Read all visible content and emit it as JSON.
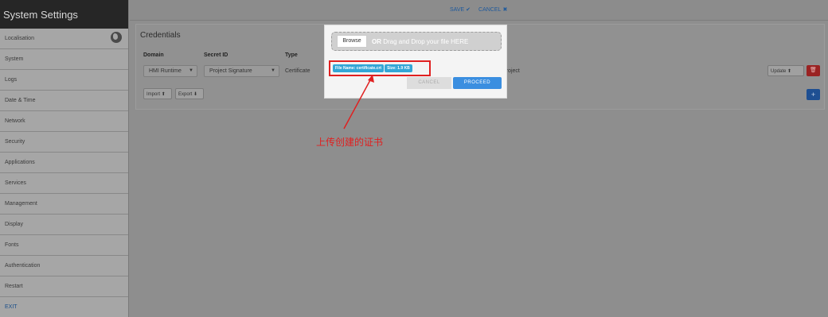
{
  "sidebar": {
    "title": "System Settings",
    "items": [
      {
        "label": "Localisation"
      },
      {
        "label": "System"
      },
      {
        "label": "Logs"
      },
      {
        "label": "Date & Time"
      },
      {
        "label": "Network"
      },
      {
        "label": "Security"
      },
      {
        "label": "Applications"
      },
      {
        "label": "Services"
      },
      {
        "label": "Management"
      },
      {
        "label": "Display"
      },
      {
        "label": "Fonts"
      },
      {
        "label": "Authentication"
      },
      {
        "label": "Restart"
      }
    ],
    "exit_label": "EXIT",
    "icon": "globe-icon"
  },
  "topbar": {
    "save_label": "SAVE",
    "cancel_label": "CANCEL",
    "save_icon": "check-icon",
    "cancel_icon": "x-icon",
    "accent_color": "#1f5a9c"
  },
  "credentials": {
    "title": "Credentials",
    "headers": {
      "domain": "Domain",
      "secret_id": "Secret ID",
      "type": "Type"
    },
    "row": {
      "domain": "HMI Runtime",
      "secret_id": "Project Signature",
      "type": "Certificate",
      "description": "e project",
      "update_label": "Update"
    },
    "import_label": "Import",
    "export_label": "Export",
    "add_label": "+"
  },
  "modal": {
    "browse_label": "Browse",
    "drop_or": "OR",
    "drop_text": " Drag and Drop your file HERE",
    "file_name_badge": "File Name: certificate.crt",
    "size_badge": "Size: 1.9 KB",
    "cancel_label": "CANCEL",
    "proceed_label": "PROCEED",
    "proceed_color": "#3a8ee0"
  },
  "annotation": {
    "text": "上传创建的证书",
    "color": "#e02020"
  }
}
